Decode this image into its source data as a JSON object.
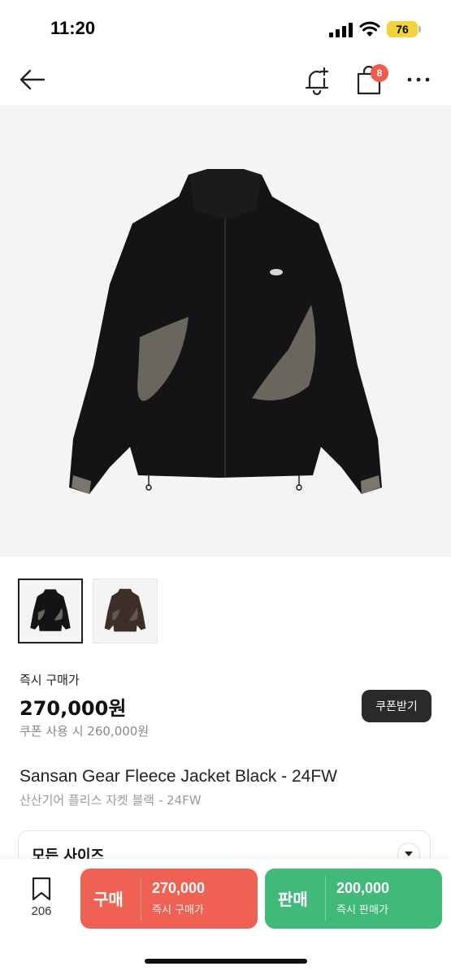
{
  "status_bar": {
    "time": "11:20",
    "battery": "76",
    "icons": [
      "signal-icon",
      "wifi-icon",
      "battery-icon"
    ]
  },
  "nav": {
    "icons": [
      "back-arrow-icon",
      "bell-plus-icon",
      "shopping-bag-icon",
      "more-icon"
    ],
    "cart_badge": "8"
  },
  "product": {
    "image_alt_icon": "black-fleece-jacket-image",
    "thumbnails": [
      "black-jacket-thumbnail",
      "brown-jacket-thumbnail"
    ],
    "price_label": "즉시 구매가",
    "price": "270,000원",
    "coupon_price": "쿠폰 사용 시 260,000원",
    "coupon_button": "쿠폰받기",
    "title_en": "Sansan Gear Fleece Jacket Black - 24FW",
    "title_ko": "산산기어 플리스 자켓 블랙 - 24FW"
  },
  "size_selector": {
    "label": "모든 사이즈"
  },
  "bottom_bar": {
    "bookmark_count": "206",
    "buy": {
      "label": "구매",
      "price": "270,000",
      "sub": "즉시 구매가"
    },
    "sell": {
      "label": "판매",
      "price": "200,000",
      "sub": "즉시 판매가"
    }
  },
  "colors": {
    "buy": "#ef6253",
    "sell": "#41b979",
    "badge": "#f05a4a",
    "coupon_button": "#2a2a2a",
    "battery": "#f2d43a"
  }
}
